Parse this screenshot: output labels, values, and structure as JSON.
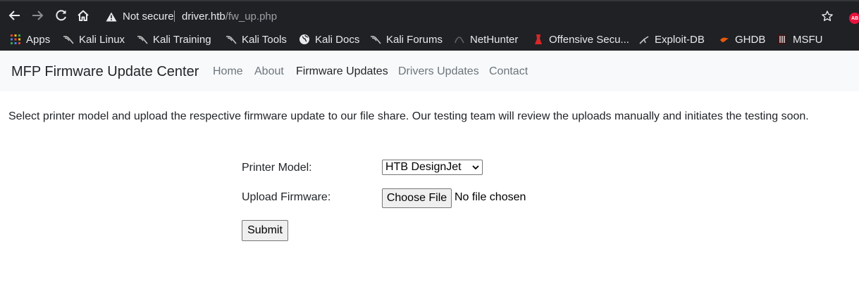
{
  "browser": {
    "security_status": "Not secure",
    "url_host": "driver.htb",
    "url_path": "/fw_up.php",
    "extension_badge": "AB",
    "bookmarks": [
      {
        "label": "Apps",
        "icon": "apps-grid-icon"
      },
      {
        "label": "Kali Linux",
        "icon": "kali-dragon-icon"
      },
      {
        "label": "Kali Training",
        "icon": "kali-dragon-icon"
      },
      {
        "label": "Kali Tools",
        "icon": "kali-dragon-icon"
      },
      {
        "label": "Kali Docs",
        "icon": "globe-icon"
      },
      {
        "label": "Kali Forums",
        "icon": "kali-dragon-icon"
      },
      {
        "label": "NetHunter",
        "icon": "nethunter-icon"
      },
      {
        "label": "Offensive Secu...",
        "icon": "offsec-icon"
      },
      {
        "label": "Exploit-DB",
        "icon": "exploit-db-icon"
      },
      {
        "label": "GHDB",
        "icon": "ghdb-icon"
      },
      {
        "label": "MSFU",
        "icon": "msfu-icon"
      }
    ]
  },
  "site": {
    "brand": "MFP Firmware Update Center",
    "nav": [
      "Home",
      "About",
      "Firmware Updates",
      "Drivers Updates",
      "Contact"
    ],
    "active_nav": "Firmware Updates"
  },
  "main": {
    "intro": "Select printer model and upload the respective firmware update to our file share. Our testing team will review the uploads manually and initiates the testing soon.",
    "form": {
      "printer_label": "Printer Model:",
      "printer_selected": "HTB DesignJet",
      "upload_label": "Upload Firmware:",
      "choose_file_label": "Choose File",
      "file_status": "No file chosen",
      "submit_label": "Submit"
    }
  },
  "colors": {
    "chrome_bg": "#202124",
    "navbar_bg": "#f8f9fa",
    "link_muted": "#6c757d",
    "link_active": "#212529",
    "text": "#212529"
  }
}
